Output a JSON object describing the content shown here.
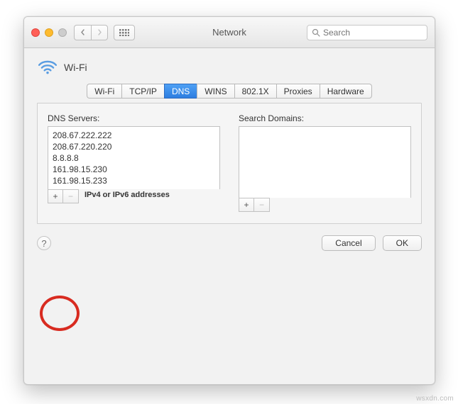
{
  "window": {
    "title": "Network"
  },
  "search": {
    "placeholder": "Search"
  },
  "header": {
    "connection_name": "Wi-Fi"
  },
  "tabs": {
    "items": [
      {
        "label": "Wi-Fi"
      },
      {
        "label": "TCP/IP"
      },
      {
        "label": "DNS"
      },
      {
        "label": "WINS"
      },
      {
        "label": "802.1X"
      },
      {
        "label": "Proxies"
      },
      {
        "label": "Hardware"
      }
    ],
    "active_index": 2
  },
  "dns": {
    "servers_label": "DNS Servers:",
    "servers": [
      "208.67.222.222",
      "208.67.220.220",
      "8.8.8.8",
      "161.98.15.230",
      "161.98.15.233"
    ],
    "hint": "IPv4 or IPv6 addresses",
    "domains_label": "Search Domains:",
    "domains": []
  },
  "buttons": {
    "plus": "+",
    "minus": "−",
    "help": "?",
    "cancel": "Cancel",
    "ok": "OK"
  },
  "watermark": "wsxdn.com"
}
